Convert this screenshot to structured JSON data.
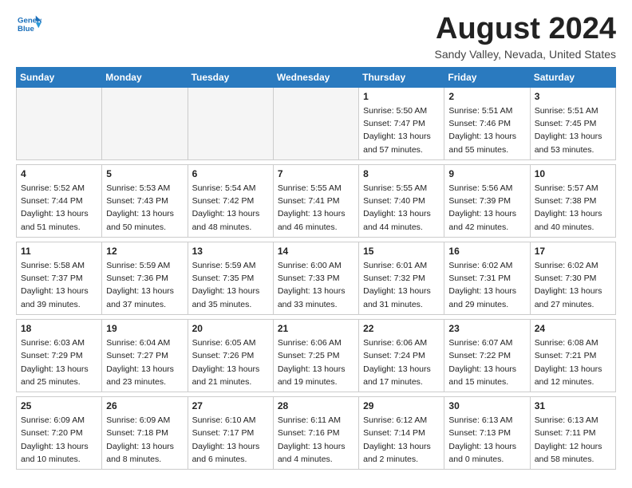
{
  "header": {
    "logo_line1": "General",
    "logo_line2": "Blue",
    "month_title": "August 2024",
    "location": "Sandy Valley, Nevada, United States"
  },
  "weekdays": [
    "Sunday",
    "Monday",
    "Tuesday",
    "Wednesday",
    "Thursday",
    "Friday",
    "Saturday"
  ],
  "rows": [
    {
      "cells": [
        {
          "day": "",
          "info": ""
        },
        {
          "day": "",
          "info": ""
        },
        {
          "day": "",
          "info": ""
        },
        {
          "day": "",
          "info": ""
        },
        {
          "day": "1",
          "info": "Sunrise: 5:50 AM\nSunset: 7:47 PM\nDaylight: 13 hours\nand 57 minutes."
        },
        {
          "day": "2",
          "info": "Sunrise: 5:51 AM\nSunset: 7:46 PM\nDaylight: 13 hours\nand 55 minutes."
        },
        {
          "day": "3",
          "info": "Sunrise: 5:51 AM\nSunset: 7:45 PM\nDaylight: 13 hours\nand 53 minutes."
        }
      ]
    },
    {
      "cells": [
        {
          "day": "4",
          "info": "Sunrise: 5:52 AM\nSunset: 7:44 PM\nDaylight: 13 hours\nand 51 minutes."
        },
        {
          "day": "5",
          "info": "Sunrise: 5:53 AM\nSunset: 7:43 PM\nDaylight: 13 hours\nand 50 minutes."
        },
        {
          "day": "6",
          "info": "Sunrise: 5:54 AM\nSunset: 7:42 PM\nDaylight: 13 hours\nand 48 minutes."
        },
        {
          "day": "7",
          "info": "Sunrise: 5:55 AM\nSunset: 7:41 PM\nDaylight: 13 hours\nand 46 minutes."
        },
        {
          "day": "8",
          "info": "Sunrise: 5:55 AM\nSunset: 7:40 PM\nDaylight: 13 hours\nand 44 minutes."
        },
        {
          "day": "9",
          "info": "Sunrise: 5:56 AM\nSunset: 7:39 PM\nDaylight: 13 hours\nand 42 minutes."
        },
        {
          "day": "10",
          "info": "Sunrise: 5:57 AM\nSunset: 7:38 PM\nDaylight: 13 hours\nand 40 minutes."
        }
      ]
    },
    {
      "cells": [
        {
          "day": "11",
          "info": "Sunrise: 5:58 AM\nSunset: 7:37 PM\nDaylight: 13 hours\nand 39 minutes."
        },
        {
          "day": "12",
          "info": "Sunrise: 5:59 AM\nSunset: 7:36 PM\nDaylight: 13 hours\nand 37 minutes."
        },
        {
          "day": "13",
          "info": "Sunrise: 5:59 AM\nSunset: 7:35 PM\nDaylight: 13 hours\nand 35 minutes."
        },
        {
          "day": "14",
          "info": "Sunrise: 6:00 AM\nSunset: 7:33 PM\nDaylight: 13 hours\nand 33 minutes."
        },
        {
          "day": "15",
          "info": "Sunrise: 6:01 AM\nSunset: 7:32 PM\nDaylight: 13 hours\nand 31 minutes."
        },
        {
          "day": "16",
          "info": "Sunrise: 6:02 AM\nSunset: 7:31 PM\nDaylight: 13 hours\nand 29 minutes."
        },
        {
          "day": "17",
          "info": "Sunrise: 6:02 AM\nSunset: 7:30 PM\nDaylight: 13 hours\nand 27 minutes."
        }
      ]
    },
    {
      "cells": [
        {
          "day": "18",
          "info": "Sunrise: 6:03 AM\nSunset: 7:29 PM\nDaylight: 13 hours\nand 25 minutes."
        },
        {
          "day": "19",
          "info": "Sunrise: 6:04 AM\nSunset: 7:27 PM\nDaylight: 13 hours\nand 23 minutes."
        },
        {
          "day": "20",
          "info": "Sunrise: 6:05 AM\nSunset: 7:26 PM\nDaylight: 13 hours\nand 21 minutes."
        },
        {
          "day": "21",
          "info": "Sunrise: 6:06 AM\nSunset: 7:25 PM\nDaylight: 13 hours\nand 19 minutes."
        },
        {
          "day": "22",
          "info": "Sunrise: 6:06 AM\nSunset: 7:24 PM\nDaylight: 13 hours\nand 17 minutes."
        },
        {
          "day": "23",
          "info": "Sunrise: 6:07 AM\nSunset: 7:22 PM\nDaylight: 13 hours\nand 15 minutes."
        },
        {
          "day": "24",
          "info": "Sunrise: 6:08 AM\nSunset: 7:21 PM\nDaylight: 13 hours\nand 12 minutes."
        }
      ]
    },
    {
      "cells": [
        {
          "day": "25",
          "info": "Sunrise: 6:09 AM\nSunset: 7:20 PM\nDaylight: 13 hours\nand 10 minutes."
        },
        {
          "day": "26",
          "info": "Sunrise: 6:09 AM\nSunset: 7:18 PM\nDaylight: 13 hours\nand 8 minutes."
        },
        {
          "day": "27",
          "info": "Sunrise: 6:10 AM\nSunset: 7:17 PM\nDaylight: 13 hours\nand 6 minutes."
        },
        {
          "day": "28",
          "info": "Sunrise: 6:11 AM\nSunset: 7:16 PM\nDaylight: 13 hours\nand 4 minutes."
        },
        {
          "day": "29",
          "info": "Sunrise: 6:12 AM\nSunset: 7:14 PM\nDaylight: 13 hours\nand 2 minutes."
        },
        {
          "day": "30",
          "info": "Sunrise: 6:13 AM\nSunset: 7:13 PM\nDaylight: 13 hours\nand 0 minutes."
        },
        {
          "day": "31",
          "info": "Sunrise: 6:13 AM\nSunset: 7:11 PM\nDaylight: 12 hours\nand 58 minutes."
        }
      ]
    }
  ]
}
